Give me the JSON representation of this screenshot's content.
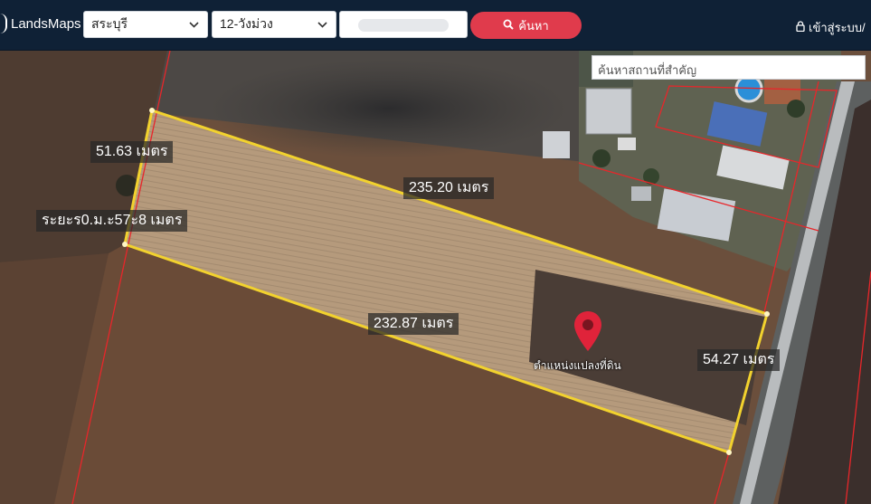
{
  "header": {
    "brand": "LandsMaps",
    "province_select": "สระบุรี",
    "district_select": "12-วังม่วง",
    "search_button": "ค้นหา",
    "login": "เข้าสู่ระบบ/"
  },
  "map": {
    "place_search_placeholder": "ค้นหาสถานที่สำคัญ",
    "labels": {
      "left_edge": "51.63 เมตร",
      "top_edge": "235.20 เมตร",
      "bottom_edge": "232.87 เมตร",
      "right_edge": "54.27 เมตร",
      "overlap": "ระยะร0.ม.ะ57ะ8 เมตร"
    },
    "marker_label": "ตำแหน่งแปลงที่ดิน"
  },
  "colors": {
    "topbar": "#0f2136",
    "accent_button": "#e03b4c",
    "parcel_outline": "#f2d22e",
    "boundary_line": "#e8262a",
    "marker": "#e0233a"
  },
  "icons": {
    "search": "search-icon",
    "lock": "lock-icon",
    "marker": "map-pin-icon",
    "chevron": "chevron-down-icon"
  }
}
